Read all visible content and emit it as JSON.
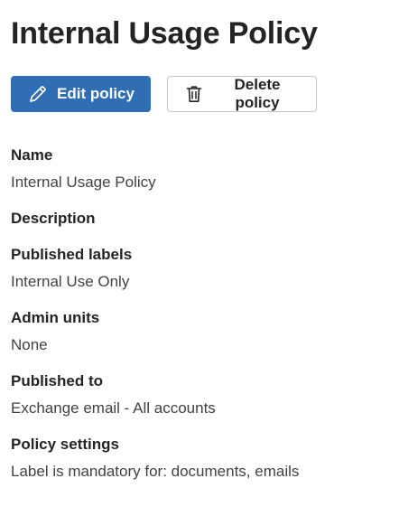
{
  "page": {
    "title": "Internal Usage Policy"
  },
  "actions": {
    "edit_label": "Edit policy",
    "edit_icon": "edit-pencil-icon",
    "delete_label": "Delete policy",
    "delete_icon": "trash-icon",
    "primary_color": "#2f6db5"
  },
  "fields": [
    {
      "label": "Name",
      "value": "Internal Usage Policy"
    },
    {
      "label": "Description",
      "value": ""
    },
    {
      "label": "Published labels",
      "value": "Internal Use Only"
    },
    {
      "label": "Admin units",
      "value": "None"
    },
    {
      "label": "Published to",
      "value": "Exchange email - All accounts"
    },
    {
      "label": "Policy settings",
      "value": "Label is mandatory for: documents, emails"
    }
  ]
}
